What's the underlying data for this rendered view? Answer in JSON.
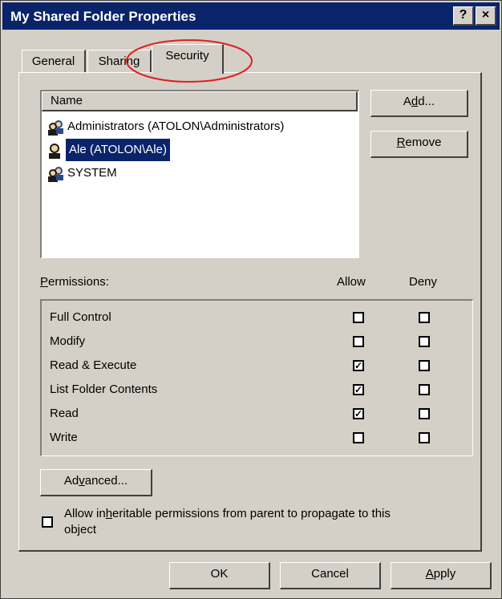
{
  "window": {
    "title": "My Shared Folder Properties",
    "help_label": "?",
    "close_label": "×"
  },
  "tabs": [
    {
      "label": "General"
    },
    {
      "label": "Sharing"
    },
    {
      "label": "Security"
    }
  ],
  "principals": {
    "column_header": "Name",
    "items": [
      {
        "name": "Administrators (ATOLON\\Administrators)",
        "selected": false
      },
      {
        "name": "Ale (ATOLON\\Ale)",
        "selected": true
      },
      {
        "name": "SYSTEM",
        "selected": false
      }
    ]
  },
  "buttons": {
    "add_pre": "A",
    "add_ul": "d",
    "add_post": "d...",
    "remove_ul": "R",
    "remove_post": "emove",
    "advanced_pre": "Ad",
    "advanced_ul": "v",
    "advanced_post": "anced...",
    "ok": "OK",
    "cancel": "Cancel",
    "apply_ul": "A",
    "apply_post": "pply"
  },
  "permissions": {
    "label_ul": "P",
    "label_post": "ermissions:",
    "allow_header": "Allow",
    "deny_header": "Deny",
    "rows": [
      {
        "name": "Full Control",
        "allow": false,
        "deny": false
      },
      {
        "name": "Modify",
        "allow": false,
        "deny": false
      },
      {
        "name": "Read & Execute",
        "allow": true,
        "deny": false
      },
      {
        "name": "List Folder Contents",
        "allow": true,
        "deny": false
      },
      {
        "name": "Read",
        "allow": true,
        "deny": false
      },
      {
        "name": "Write",
        "allow": false,
        "deny": false
      }
    ]
  },
  "inherit": {
    "pre": "Allow in",
    "ul": "h",
    "post": "eritable permissions from parent to propagate to this",
    "line2": "object",
    "checked": false
  },
  "colors": {
    "title_bg": "#0a246a",
    "selection_bg": "#0a246a",
    "face": "#d4d0c8",
    "highlight_circle": "#e02020"
  }
}
